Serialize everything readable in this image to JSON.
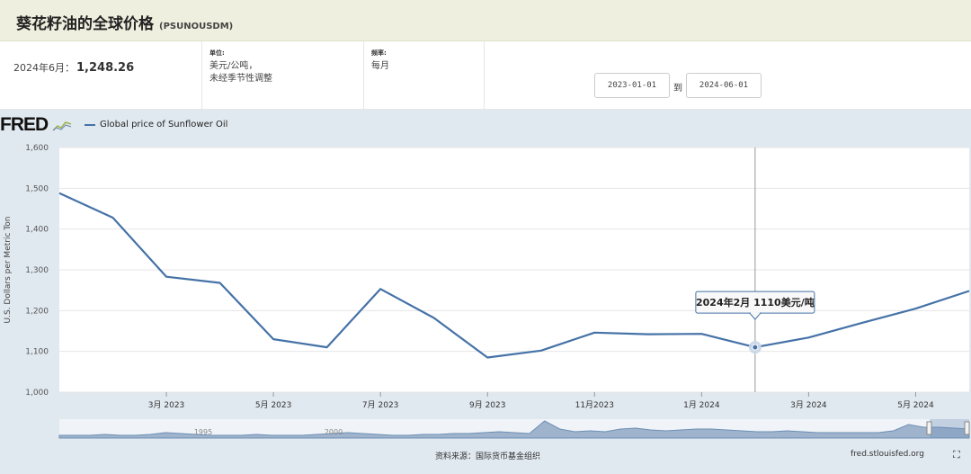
{
  "header": {
    "title": "葵花籽油的全球价格",
    "code": "(PSUNOUSDM)"
  },
  "info": {
    "latest_label": "2024年6月：",
    "latest_value": "1,248.26",
    "units_label": "单位:",
    "units_line1": "美元/公吨，",
    "units_line2": "未经季节性调整",
    "freq_label": "频率:",
    "freq_value": "每月"
  },
  "date_range": {
    "start": "2023-01-01",
    "to_label": "到",
    "end": "2024-06-01"
  },
  "logo": "FRED",
  "legend_label": "Global price of Sunflower Oil",
  "tooltip": "2024年2月 1110美元/吨",
  "footer": {
    "source": "资料来源：国际货币基金组织",
    "site": "fred.stlouisfed.org"
  },
  "colors": {
    "line": "#4572a7",
    "plot_bg": "#ffffff",
    "chart_bg": "#e1e9f0"
  },
  "navigator_labels": [
    "1995",
    "2000"
  ],
  "chart_data": {
    "type": "line",
    "title": "Global price of Sunflower Oil",
    "ylabel": "U.S. Dollars per Metric Ton",
    "ylim": [
      1000,
      1600
    ],
    "yticks": [
      "1,000",
      "1,100",
      "1,200",
      "1,300",
      "1,400",
      "1,500",
      "1,600"
    ],
    "x": [
      "2023-01",
      "2023-02",
      "2023-03",
      "2023-04",
      "2023-05",
      "2023-06",
      "2023-07",
      "2023-08",
      "2023-09",
      "2023-10",
      "2023-11",
      "2023-12",
      "2024-01",
      "2024-02",
      "2024-03",
      "2024-04",
      "2024-05",
      "2024-06"
    ],
    "xtick_labels": [
      {
        "x": "2023-03",
        "label": "3月 2023"
      },
      {
        "x": "2023-05",
        "label": "5月 2023"
      },
      {
        "x": "2023-07",
        "label": "7月 2023"
      },
      {
        "x": "2023-09",
        "label": "9月 2023"
      },
      {
        "x": "2023-11",
        "label": "11月2023"
      },
      {
        "x": "2024-01",
        "label": "1月 2024"
      },
      {
        "x": "2024-03",
        "label": "3月 2024"
      },
      {
        "x": "2024-05",
        "label": "5月 2024"
      }
    ],
    "series": [
      {
        "name": "Global price of Sunflower Oil",
        "values": [
          1488,
          1428,
          1283,
          1268,
          1130,
          1110,
          1253,
          1182,
          1085,
          1102,
          1146,
          1142,
          1143,
          1110,
          1134,
          1170,
          1205,
          1248.26
        ]
      }
    ],
    "highlight": {
      "x": "2024-02",
      "value": 1110
    }
  }
}
